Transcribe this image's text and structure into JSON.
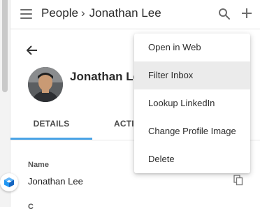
{
  "header": {
    "breadcrumb_root": "People",
    "breadcrumb_separator": "›",
    "breadcrumb_current": "Jonathan Lee"
  },
  "profile": {
    "name": "Jonathan Lee"
  },
  "tabs": [
    {
      "label": "DETAILS",
      "active": true
    },
    {
      "label": "ACTI",
      "active": false
    }
  ],
  "details": {
    "field_label": "Name",
    "field_value": "Jonathan Lee",
    "next_label": "C"
  },
  "dropdown": {
    "items": [
      {
        "label": "Open in Web"
      },
      {
        "label": "Filter Inbox",
        "highlighted": true
      },
      {
        "label": "Lookup LinkedIn"
      },
      {
        "label": "Change Profile Image"
      },
      {
        "label": "Delete"
      }
    ]
  },
  "colors": {
    "accent": "#4aa3e6",
    "badge": "#2196f3",
    "menu_hover": "#ebebeb"
  },
  "icons": [
    "menu-icon",
    "search-icon",
    "add-icon",
    "back-arrow-icon",
    "copy-icon",
    "app-badge-icon"
  ]
}
